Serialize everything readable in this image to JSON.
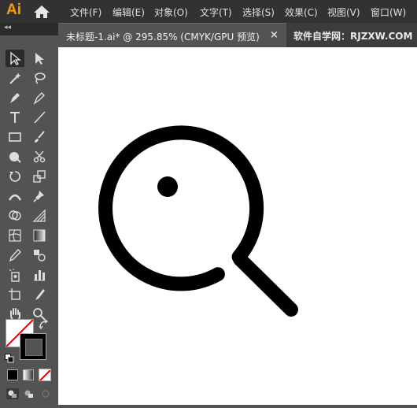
{
  "app": {
    "logo": "Ai"
  },
  "menu": [
    {
      "label": "文件(F)",
      "id": "file"
    },
    {
      "label": "编辑(E)",
      "id": "edit"
    },
    {
      "label": "对象(O)",
      "id": "object"
    },
    {
      "label": "文字(T)",
      "id": "type"
    },
    {
      "label": "选择(S)",
      "id": "select"
    },
    {
      "label": "效果(C)",
      "id": "effect"
    },
    {
      "label": "视图(V)",
      "id": "view"
    },
    {
      "label": "窗口(W)",
      "id": "window"
    }
  ],
  "panel": {
    "collapse_glyph": "◂◂"
  },
  "document_tab": {
    "title": "未标题-1.ai* @ 295.85% (CMYK/GPU 预览)",
    "close_glyph": "×"
  },
  "watermark": "软件自学网：RJZXW.COM",
  "colors": {
    "menubar": "#323232",
    "workspace": "#535353",
    "artboard": "#ffffff",
    "logo": "#ff9a00",
    "artwork_stroke": "#000000",
    "none_slash": "#e00000"
  },
  "tools": [
    "selection-tool",
    "direct-selection-tool",
    "magic-wand-tool",
    "lasso-tool",
    "pen-tool",
    "curvature-tool",
    "type-tool",
    "line-segment-tool",
    "rectangle-tool",
    "paintbrush-tool",
    "shaper-tool",
    "scissors-tool",
    "rotate-tool",
    "scale-tool",
    "width-tool",
    "puppet-warp-tool",
    "shape-builder-tool",
    "perspective-grid-tool",
    "mesh-tool",
    "gradient-tool",
    "eyedropper-tool",
    "blend-tool",
    "symbol-sprayer-tool",
    "column-graph-tool",
    "artboard-tool",
    "slice-tool",
    "hand-tool",
    "zoom-tool"
  ],
  "artwork": {
    "description_icon": "magnifier-with-dot-icon"
  }
}
